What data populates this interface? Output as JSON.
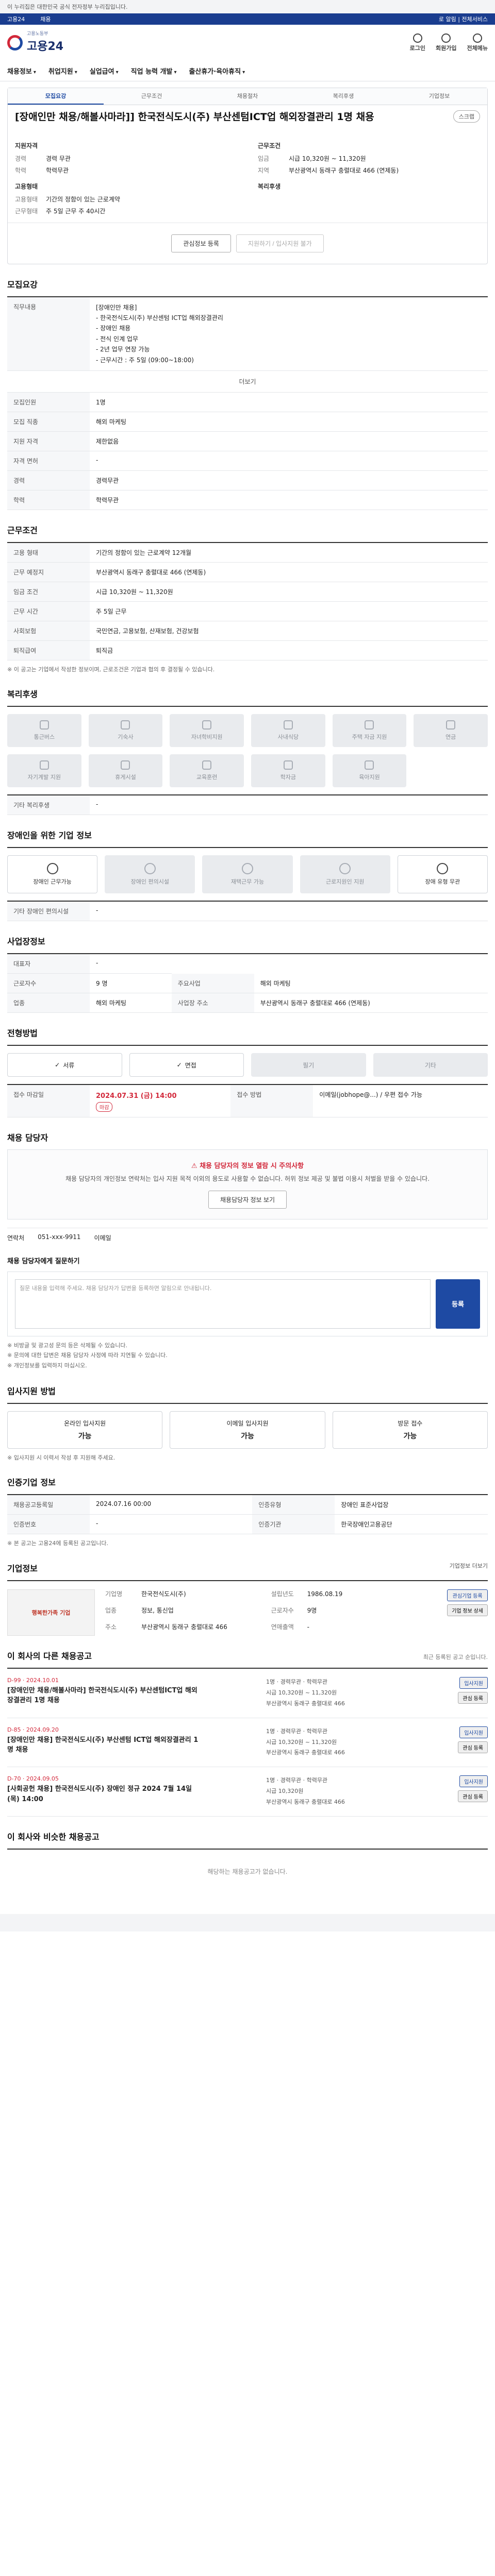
{
  "top_notice": "이 누리집은 대한민국 공식 전자정부 누리집입니다.",
  "gov_bar": {
    "left": [
      "고용24",
      "채용"
    ],
    "right": "로 알림 | 전체서비스"
  },
  "header": {
    "logo": "고용24",
    "logo_sub": "고용노동부",
    "icons": [
      "로그인",
      "회원가입",
      "전체메뉴"
    ]
  },
  "gnb": [
    "채용정보",
    "취업지원",
    "실업급여",
    "직업 능력 개발",
    "출산휴가·육아휴직"
  ],
  "summary": {
    "tabs": [
      "모집요강",
      "근무조건",
      "채용절차",
      "복리후생",
      "기업정보"
    ],
    "title": "[장애인만 채용/해볼사마라]] 한국전식도시(주) 부산센텀ICT업 해외장결관리 1명 채용",
    "scrap": "스크랩",
    "left_head": "지원자격",
    "left": [
      {
        "k": "경력",
        "v": "경력 무관"
      },
      {
        "k": "학력",
        "v": "학력무관"
      }
    ],
    "right_head": "근무조건",
    "right": [
      {
        "k": "임금",
        "v": "시급 10,320원 ~ 11,320원"
      },
      {
        "k": "지역",
        "v": "부산광역시 동래구 충렬대로 466 (연제동)"
      }
    ],
    "left_head2": "고용형태",
    "left2": [
      {
        "k": "고용형태",
        "v": "기간의 정함이 있는 근로계약"
      },
      {
        "k": "근무형태",
        "v": "주 5일 근무 주 40시간"
      }
    ],
    "right_head2": "복리후생",
    "actions": [
      "관심정보 등록",
      "지원하기 / 입사지원 불가"
    ]
  },
  "recruit": {
    "title": "모집요강",
    "rows": [
      {
        "k": "직무내용",
        "v": "[장애인만 채용]\n - 한국전식도시(주) 부산센텀 ICT업 해외장결관리\n - 장애인 채용\n - 전식 인계 업무\n - 2년 업무 연장 가능\n - 근무시간 : 주 5일 (09:00~18:00)"
      },
      {
        "k": "모집인원",
        "v": "1명"
      },
      {
        "k": "모집 직종",
        "v": "해외 마케팅"
      },
      {
        "k": "지원 자격",
        "v": "제한없음"
      },
      {
        "k": "자격 면허",
        "v": "-"
      },
      {
        "k": "경력",
        "v": "경력무관"
      },
      {
        "k": "학력",
        "v": "학력무관"
      }
    ],
    "more": "더보기"
  },
  "work": {
    "title": "근무조건",
    "rows": [
      {
        "k": "고용 형태",
        "v": "기간의 정함이 있는 근로계약 12개월"
      },
      {
        "k": "근무 예정지",
        "v": "부산광역시 동래구 충렬대로 466 (연제동)"
      },
      {
        "k": "임금 조건",
        "v": "시급 10,320원 ~ 11,320원"
      },
      {
        "k": "근무 시간",
        "v": "주 5일 근무"
      },
      {
        "k": "사회보험",
        "v": "국민연금, 고용보험, 산재보험, 건강보험"
      },
      {
        "k": "퇴직급여",
        "v": "퇴직금"
      }
    ],
    "note": "※ 이 공고는 기업에서 작성한 정보이며, 근로조건은 기업과 협의 후 결정될 수 있습니다."
  },
  "welfare": {
    "title": "복리후생",
    "items": [
      "통근버스",
      "기숙사",
      "자녀학비지원",
      "사내식당",
      "주택 자금 지원",
      "연금",
      "자기계발 지원",
      "휴게시설",
      "교육훈련",
      "학자금",
      "육아지원"
    ],
    "extra_label": "기타 복리후생",
    "extra": "-"
  },
  "disability": {
    "title": "장애인을 위한 기업 정보",
    "items": [
      {
        "label": "장애인 근무가능",
        "on": true
      },
      {
        "label": "장애인 편의시설",
        "on": false
      },
      {
        "label": "재택근무 가능",
        "on": false
      },
      {
        "label": "근로지원인 지원",
        "on": false
      },
      {
        "label": "장애 유형 무관",
        "on": true
      }
    ],
    "note_label": "기타 장애인 편의시설",
    "note": "-"
  },
  "company_info": {
    "title": "사업장정보",
    "rows": [
      {
        "k": "대표자",
        "v": "-"
      },
      {
        "k": "근로자수",
        "v": "9 명"
      },
      {
        "k": "업종",
        "v": "해외 마케팅"
      }
    ],
    "rows2": [
      {
        "k": "주요사업",
        "v": "해외 마케팅"
      },
      {
        "k": "사업장 주소",
        "v": "부산광역시 동래구 충렬대로 466 (연제동)"
      }
    ]
  },
  "process": {
    "title": "전형방법",
    "methods": [
      {
        "label": "서류",
        "on": true
      },
      {
        "label": "면접",
        "on": true
      },
      {
        "label": "필기",
        "on": false
      },
      {
        "label": "기타",
        "on": false
      }
    ],
    "deadline_label": "접수 마감일",
    "deadline": "2024.07.31 (금) 14:00",
    "dday": "마감",
    "how_label": "접수 방법",
    "how": "이메일(jobhope@...) / 우편 접수 가능"
  },
  "contact": {
    "title": "채용 담당자",
    "warn": "채용 담당자의 정보 열람 시 주의사항",
    "notice": "채용 담당자의 개인정보 연락처는 입사 지원 목적 이외의 용도로 사용할 수 없습니다. 허위 정보 제공 및 불법 이용시 처벌을 받을 수 있습니다.",
    "button": "채용담당자 정보 보기",
    "phone_label": "연락처",
    "phone": "051-xxx-9911",
    "fax_label": "이메일",
    "qa_label": "채용 담당자에게 질문하기",
    "qa_placeholder": "질문 내용을 입력해 주세요. 채용 담당자가 답변을 등록하면 알림으로 안내됩니다.",
    "qa_button": "등록",
    "qa_bullets": [
      "※ 비방글 및 광고성 문의 등은 삭제될 수 있습니다.",
      "※ 문의에 대한 답변은 채용 담당자 사정에 따라 지연될 수 있습니다.",
      "※ 개인정보를 입력하지 마십시오."
    ]
  },
  "submit": {
    "title": "입사지원 방법",
    "cards": [
      {
        "label": "온라인 입사지원",
        "value": "가능"
      },
      {
        "label": "이메일 입사지원",
        "value": "가능"
      },
      {
        "label": "방문 접수",
        "value": "가능"
      }
    ],
    "note": "※ 입사지원 시 이력서 작성 후 지원해 주세요."
  },
  "official": {
    "title": "인증기업 정보",
    "rows": [
      {
        "k": "채용공고등록일",
        "v": "2024.07.16 00:00"
      },
      {
        "k": "인증유형",
        "v": "장애인 표준사업장"
      }
    ],
    "rows2": [
      {
        "k": "인증번호",
        "v": "-"
      },
      {
        "k": "인증기관",
        "v": "한국장애인고용공단"
      }
    ],
    "note": "※ 본 공고는 고용24에 등록된 공고입니다."
  },
  "company": {
    "title": "기업정보",
    "more": "기업정보 더보기",
    "logo_text": "행복한가족 기업",
    "info": [
      {
        "k": "기업명",
        "v": "한국전식도시(주)"
      },
      {
        "k": "설립년도",
        "v": "1986.08.19"
      },
      {
        "k": "업종",
        "v": "정보, 통신업"
      },
      {
        "k": "근로자수",
        "v": "9명"
      },
      {
        "k": "주소",
        "v": "부산광역시 동래구 충렬대로 466"
      },
      {
        "k": "연매출액",
        "v": "-"
      }
    ],
    "buttons": [
      "관심기업 등록",
      "기업 정보 상세"
    ]
  },
  "related": {
    "title": "이 회사의 다른 채용공고",
    "note": "최근 등록된 공고 순입니다.",
    "items": [
      {
        "date": "D-99 · 2024.10.01",
        "title": "[장애인만 채용/해볼사마라] 한국전식도시(주) 부산센텀ICT업 해외장결관리 1명 채용",
        "meta": [
          "1명 · 경력무관 · 학력무관",
          "시급 10,320원 ~ 11,320원",
          "부산광역시 동래구 충렬대로 466"
        ],
        "actions": [
          "입사지원",
          "관심 등록"
        ]
      },
      {
        "date": "D-85 · 2024.09.20",
        "title": "[장애인만 채용] 한국전식도시(주) 부산센텀 ICT업 해외장결관리 1명 채용",
        "meta": [
          "1명 · 경력무관 · 학력무관",
          "시급 10,320원 ~ 11,320원",
          "부산광역시 동래구 충렬대로 466"
        ],
        "actions": [
          "입사지원",
          "관심 등록"
        ]
      },
      {
        "date": "D-70 · 2024.09.05",
        "title": "[사회공헌 채용] 한국전식도시(주) 장애인 정규 2024 7월 14일(목) 14:00",
        "meta": [
          "1명 · 경력무관 · 학력무관",
          "시급 10,320원",
          "부산광역시 동래구 충렬대로 466"
        ],
        "actions": [
          "입사지원",
          "관심 등록"
        ]
      }
    ]
  },
  "similar": {
    "title": "이 회사와 비슷한 채용공고",
    "empty": "해당하는 채용공고가 없습니다."
  }
}
